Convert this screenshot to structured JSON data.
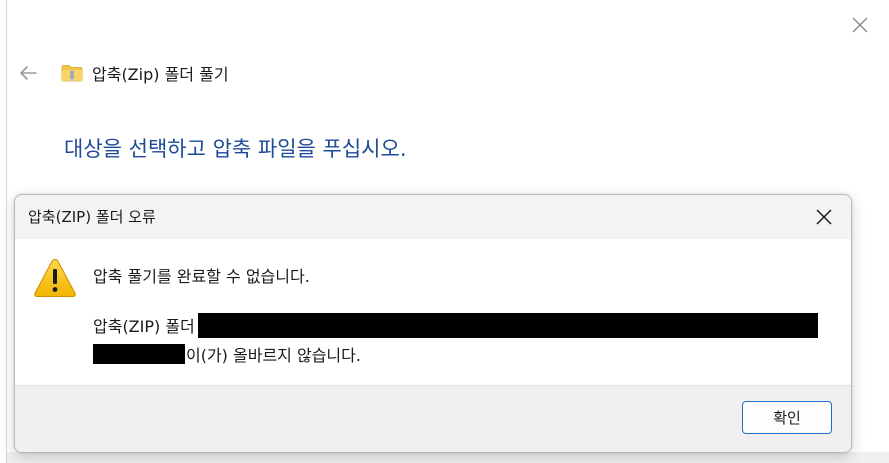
{
  "wizard": {
    "close_icon": "close-icon",
    "back_icon": "back-arrow-icon",
    "folder_icon": "zip-folder-icon",
    "title": "압축(Zip) 폴더 풀기",
    "heading": "대상을 선택하고 압축 파일을 푸십시오.",
    "heading_color": "#1f4a99"
  },
  "dialog": {
    "title": "압축(ZIP) 폴더 오류",
    "close_icon": "close-icon",
    "warning_icon": "warning-icon",
    "message_main": "압축 풀기를 완료할 수 없습니다.",
    "message_detail_prefix": "압축(ZIP) 폴더",
    "message_detail_suffix": "이(가) 올바르지 않습니다.",
    "ok_label": "확인",
    "accent_color": "#1f6fcf"
  }
}
